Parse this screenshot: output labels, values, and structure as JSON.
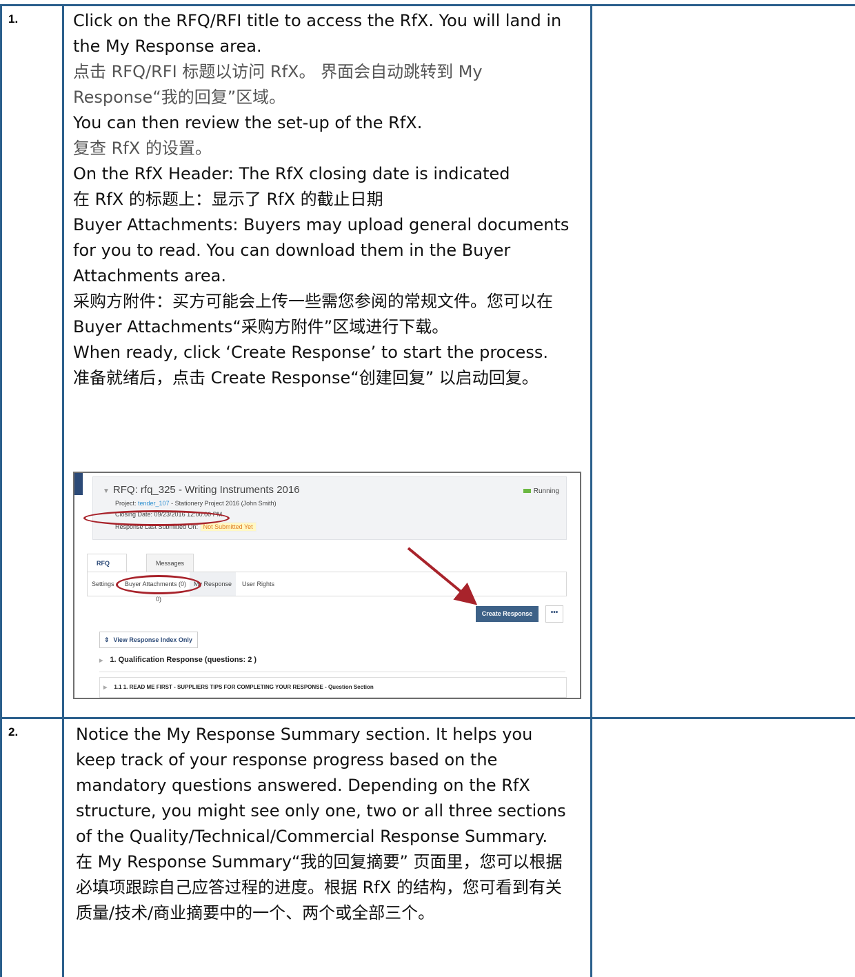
{
  "rows": [
    {
      "number": "1.",
      "paragraphs": [
        "Click on the RFQ/RFI title to access the RfX.  You will land in the My Response area.",
        "点击 RFQ/RFI 标题以访问 RfX。 界面会自动跳转到 My Response“我的回复”区域。",
        "You can then review the set-up of the RfX.",
        "复查 RfX 的设置。",
        "On the RfX Header: The RfX closing date is indicated",
        "在 RfX 的标题上：显示了 RfX 的截止日期",
        "Buyer Attachments: Buyers may upload general documents for you to read. You can download them in the Buyer Attachments area.",
        "采购方附件：买方可能会上传一些需您参阅的常规文件。您可以在 Buyer Attachments“采购方附件”区域进行下载。",
        "When ready, click ‘Create Response’ to start the process.",
        "准备就绪后，点击 Create Response“创建回复” 以启动回复。"
      ]
    },
    {
      "number": "2.",
      "paragraphs": [
        "Notice the My Response Summary section. It helps you keep track of your response progress based on the mandatory questions answered.  Depending on the RfX structure, you might see only one, two or all three sections of the Quality/Technical/Commercial Response Summary.",
        "在 My Response Summary“我的回复摘要” 页面里，您可以根据必填项跟踪自己应答过程的进度。根据 RfX 的结构，您可看到有关质量/技术/商业摘要中的一个、两个或全部三个。"
      ]
    }
  ],
  "screenshot": {
    "title": "RFQ: rfq_325 - Writing Instruments 2016",
    "status": "Running",
    "project_label": "Project:",
    "project_link": "tender_107",
    "project_rest": " - Stationery Project 2016 (John Smith)",
    "closing_date": "Closing Date: 09/23/2016 12:00:00 PM",
    "last_submitted_label": "Response Last Submitted On:",
    "last_submitted_value": "Not Submitted Yet",
    "tabs": [
      "RFQ Details",
      "Messages (Unread 0)"
    ],
    "subtabs": [
      "Settings",
      "Buyer Attachments (0)",
      "My Response",
      "User Rights"
    ],
    "create_button": "Create Response",
    "more_button": "•••",
    "index_button": "View Response Index Only",
    "section_1": "1. Qualification Response (questions: 2 )",
    "section_1_1": "1.1  1. READ ME FIRST - SUPPLIERS TIPS FOR COMPLETING YOUR RESPONSE - Question Section"
  }
}
